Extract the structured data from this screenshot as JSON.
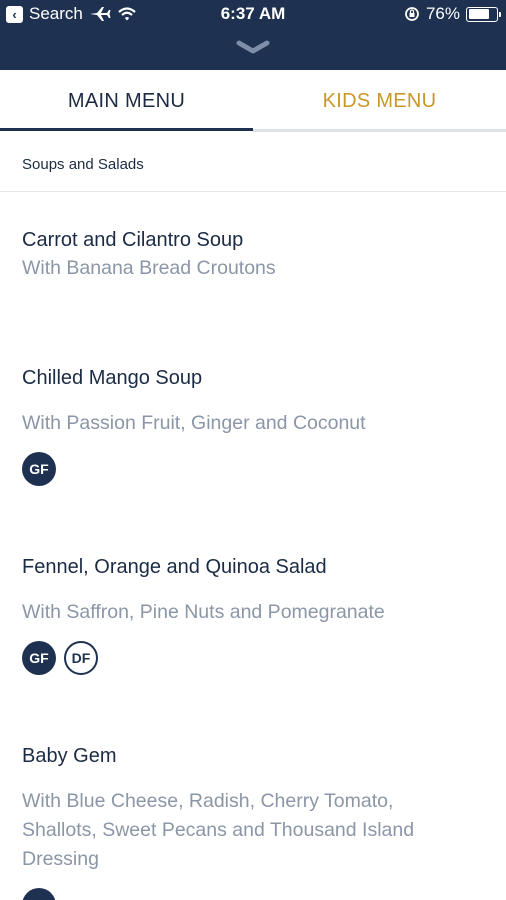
{
  "status_bar": {
    "back_label": "Search",
    "time": "6:37 AM",
    "battery": "76%"
  },
  "tabs": [
    {
      "label": "MAIN MENU"
    },
    {
      "label": "KIDS MENU"
    }
  ],
  "section": {
    "title": "Soups and Salads"
  },
  "items": [
    {
      "name": "Carrot and Cilantro Soup",
      "description": "With Banana Bread Croutons"
    },
    {
      "name": "Chilled Mango Soup",
      "description": "With Passion Fruit, Ginger and Coconut",
      "badges": [
        "GF"
      ]
    },
    {
      "name": "Fennel, Orange and Quinoa Salad",
      "description": "With Saffron, Pine Nuts and Pomegranate",
      "badges": [
        "GF",
        "DF"
      ]
    },
    {
      "name": "Baby Gem",
      "description_lines": [
        "With Blue Cheese, Radish, Cherry Tomato,",
        "Shallots, Sweet Pecans and Thousand Island",
        "Dressing"
      ]
    }
  ],
  "colors": {
    "nav": "#1f3150",
    "accent": "#c8982a",
    "muted": "#8b96a6"
  }
}
